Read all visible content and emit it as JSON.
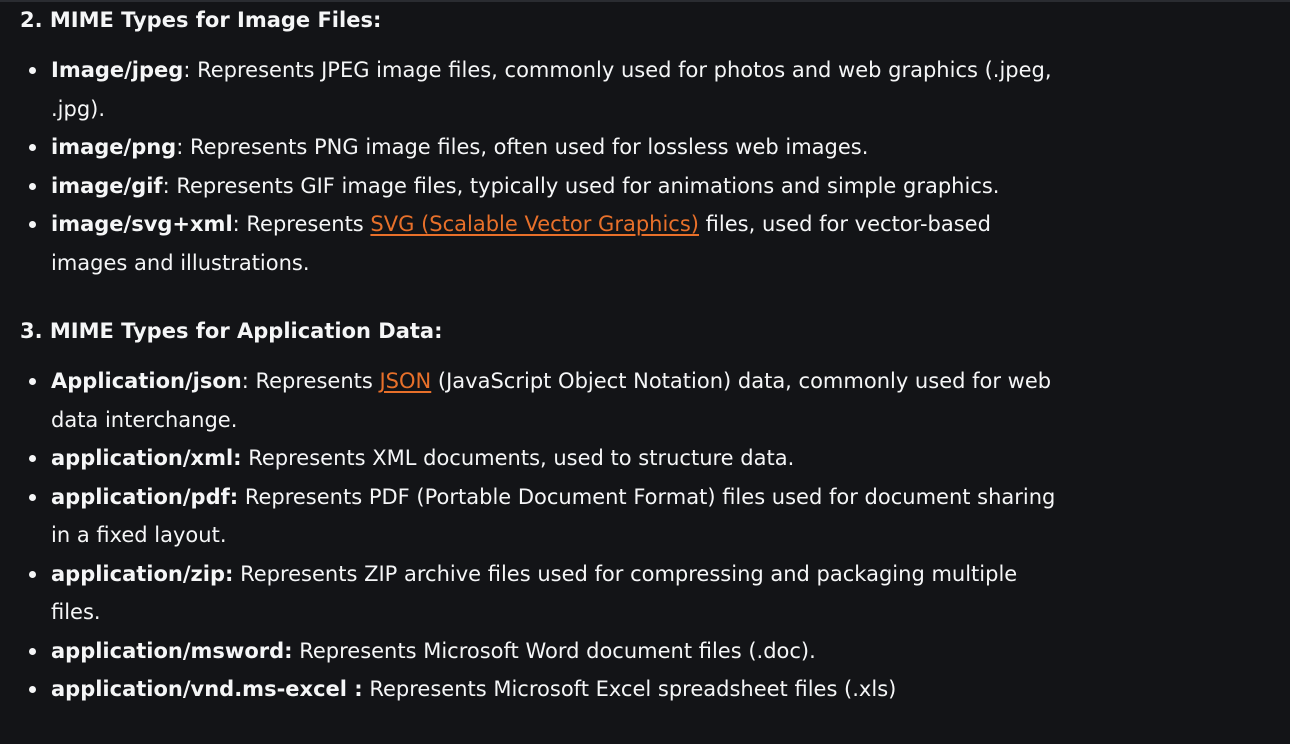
{
  "section_image": {
    "heading": "2. MIME Types for Image Files:",
    "items": [
      {
        "term": "Image/jpeg",
        "sep": ": ",
        "desc": "Represents JPEG image files, commonly used for photos and web graphics (.jpeg, .jpg)."
      },
      {
        "term": "image/png",
        "sep": ": ",
        "desc": "Represents PNG image files, often used for lossless web images."
      },
      {
        "term": "image/gif",
        "sep": ": ",
        "desc": "Represents GIF image files, typically used for animations and simple graphics."
      },
      {
        "term": "image/svg+xml",
        "sep": ": ",
        "desc_before": "Represents ",
        "link": "SVG (Scalable Vector Graphics)",
        "desc_after": " files, used for vector-based images and illustrations."
      }
    ]
  },
  "section_application": {
    "heading": "3. MIME Types for Application Data:",
    "items": [
      {
        "term": "Application/json",
        "sep": ": ",
        "desc_before": "Represents ",
        "link": "JSON",
        "desc_after": " (JavaScript Object Notation) data, commonly used for web data interchange."
      },
      {
        "term": "application/xml:",
        "desc": " Represents XML documents, used to structure data."
      },
      {
        "term": "application/pdf:",
        "desc": " Represents PDF (Portable Document Format) files used for document sharing in a fixed layout."
      },
      {
        "term": "application/zip:",
        "desc": " Represents ZIP archive files used for compressing and packaging multiple files."
      },
      {
        "term": "application/msword:",
        "desc": " Represents Microsoft Word document files (.doc)."
      },
      {
        "term": "application/vnd.ms-excel :",
        "desc": " Represents Microsoft Excel spreadsheet files (.xls)"
      }
    ]
  },
  "colors": {
    "background": "#131417",
    "text": "#f5f6f7",
    "link": "#e8702a"
  }
}
